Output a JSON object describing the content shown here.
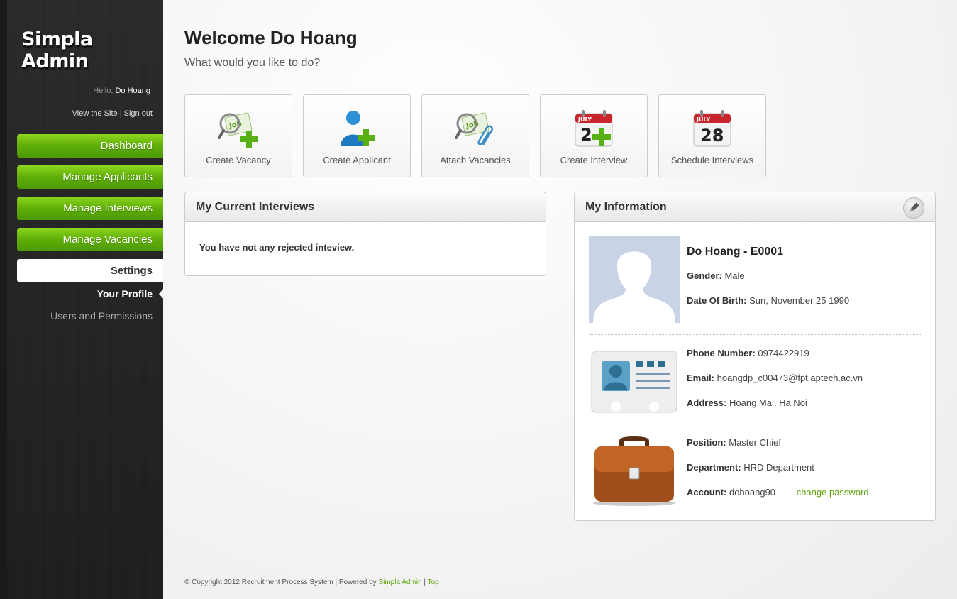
{
  "sidebar": {
    "logo": "Simpla Admin",
    "hello_prefix": "Hello,",
    "user_name": "Do Hoang",
    "view_site": "View the Site",
    "separator": "|",
    "sign_out": "Sign out",
    "nav": [
      {
        "label": "Dashboard"
      },
      {
        "label": "Manage Applicants"
      },
      {
        "label": "Manage Interviews"
      },
      {
        "label": "Manage Vacancies"
      },
      {
        "label": "Settings"
      }
    ],
    "sub_nav": [
      {
        "label": "Your Profile"
      },
      {
        "label": "Users and Permissions"
      }
    ]
  },
  "main": {
    "title": "Welcome Do Hoang",
    "subtitle": "What would you like to do?",
    "shortcuts": [
      {
        "label": "Create Vacancy",
        "icon": "job-search-add-icon"
      },
      {
        "label": "Create Applicant",
        "icon": "user-add-icon"
      },
      {
        "label": "Attach Vacancies",
        "icon": "job-search-attach-icon"
      },
      {
        "label": "Create Interview",
        "icon": "calendar-add-icon"
      },
      {
        "label": "Schedule Interviews",
        "icon": "calendar-icon"
      }
    ],
    "calendar": {
      "month": "JULY",
      "day": "28",
      "day_partial": "2"
    },
    "job_tag": "Job"
  },
  "interviews": {
    "title": "My Current Interviews",
    "message": "You have not any rejected inteview."
  },
  "info": {
    "title": "My Information",
    "full_name": "Do Hoang - E0001",
    "gender_label": "Gender:",
    "gender": "Male",
    "dob_label": "Date Of Birth:",
    "dob": "Sun, November 25 1990",
    "phone_label": "Phone Number:",
    "phone": "0974422919",
    "email_label": "Email:",
    "email": "hoangdp_c00473@fpt.aptech.ac.vn",
    "address_label": "Address:",
    "address": "Hoang Mai, Ha Noi",
    "position_label": "Position:",
    "position": "Master Chief",
    "department_label": "Department:",
    "department": "HRD Department",
    "account_label": "Account:",
    "account": "dohoang90",
    "account_sep": "-",
    "change_password": "change password"
  },
  "footer": {
    "copyright": "© Copyright 2012 Recruitment Process System | Powered by",
    "powered_by": "Simpla Admin",
    "sep": "|",
    "top": "Top"
  },
  "colors": {
    "accent_green": "#5fae08",
    "link_green": "#5aa30a",
    "sidebar_bg": "#262626"
  }
}
